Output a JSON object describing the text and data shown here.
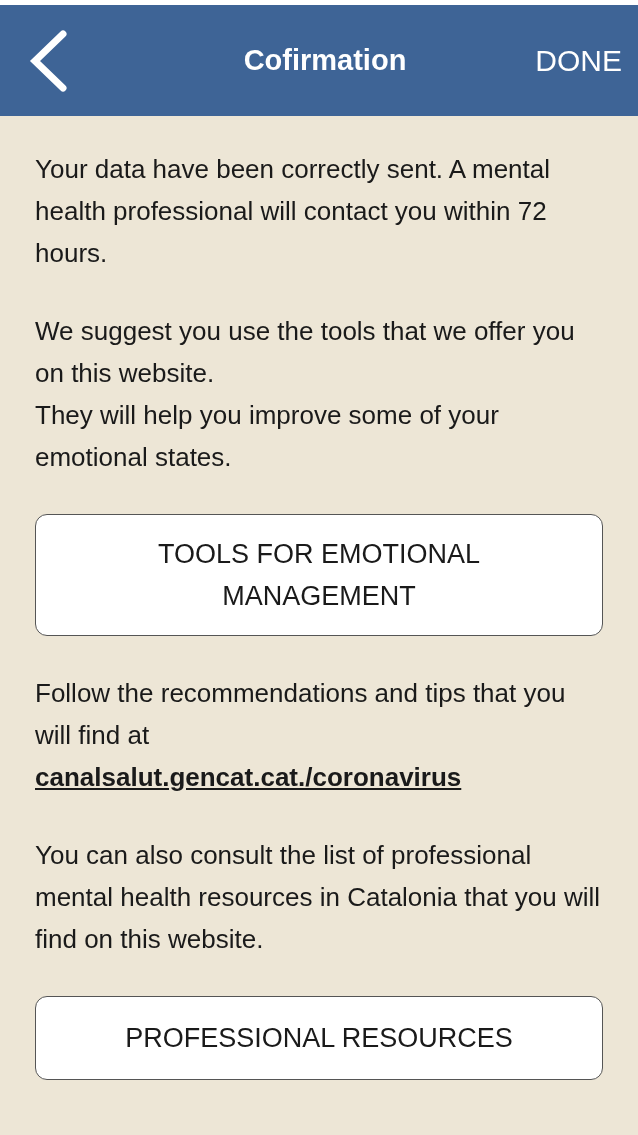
{
  "header": {
    "title": "Cofirmation",
    "action": "DONE"
  },
  "content": [
    {
      "kind": "paragraph",
      "lines": [
        "Your data have been correctly sent. A mental health professional will contact you within 72 hours."
      ]
    },
    {
      "kind": "paragraph",
      "lines": [
        "We suggest you use the tools that we offer you on this website.",
        "They will help you improve some of your emotional states."
      ]
    },
    {
      "kind": "button",
      "label": "TOOLS FOR EMOTIONAL MANAGEMENT"
    },
    {
      "kind": "paragraph",
      "lines": [
        "Follow the recommendations and tips that you will find at"
      ],
      "link": "canalsalut.gencat.cat./coronavirus"
    },
    {
      "kind": "paragraph",
      "lines": [
        "You can also consult the list of professional mental health resources in Catalonia that you will find on this website."
      ]
    },
    {
      "kind": "button",
      "label": "PROFESSIONAL RESOURCES"
    }
  ]
}
